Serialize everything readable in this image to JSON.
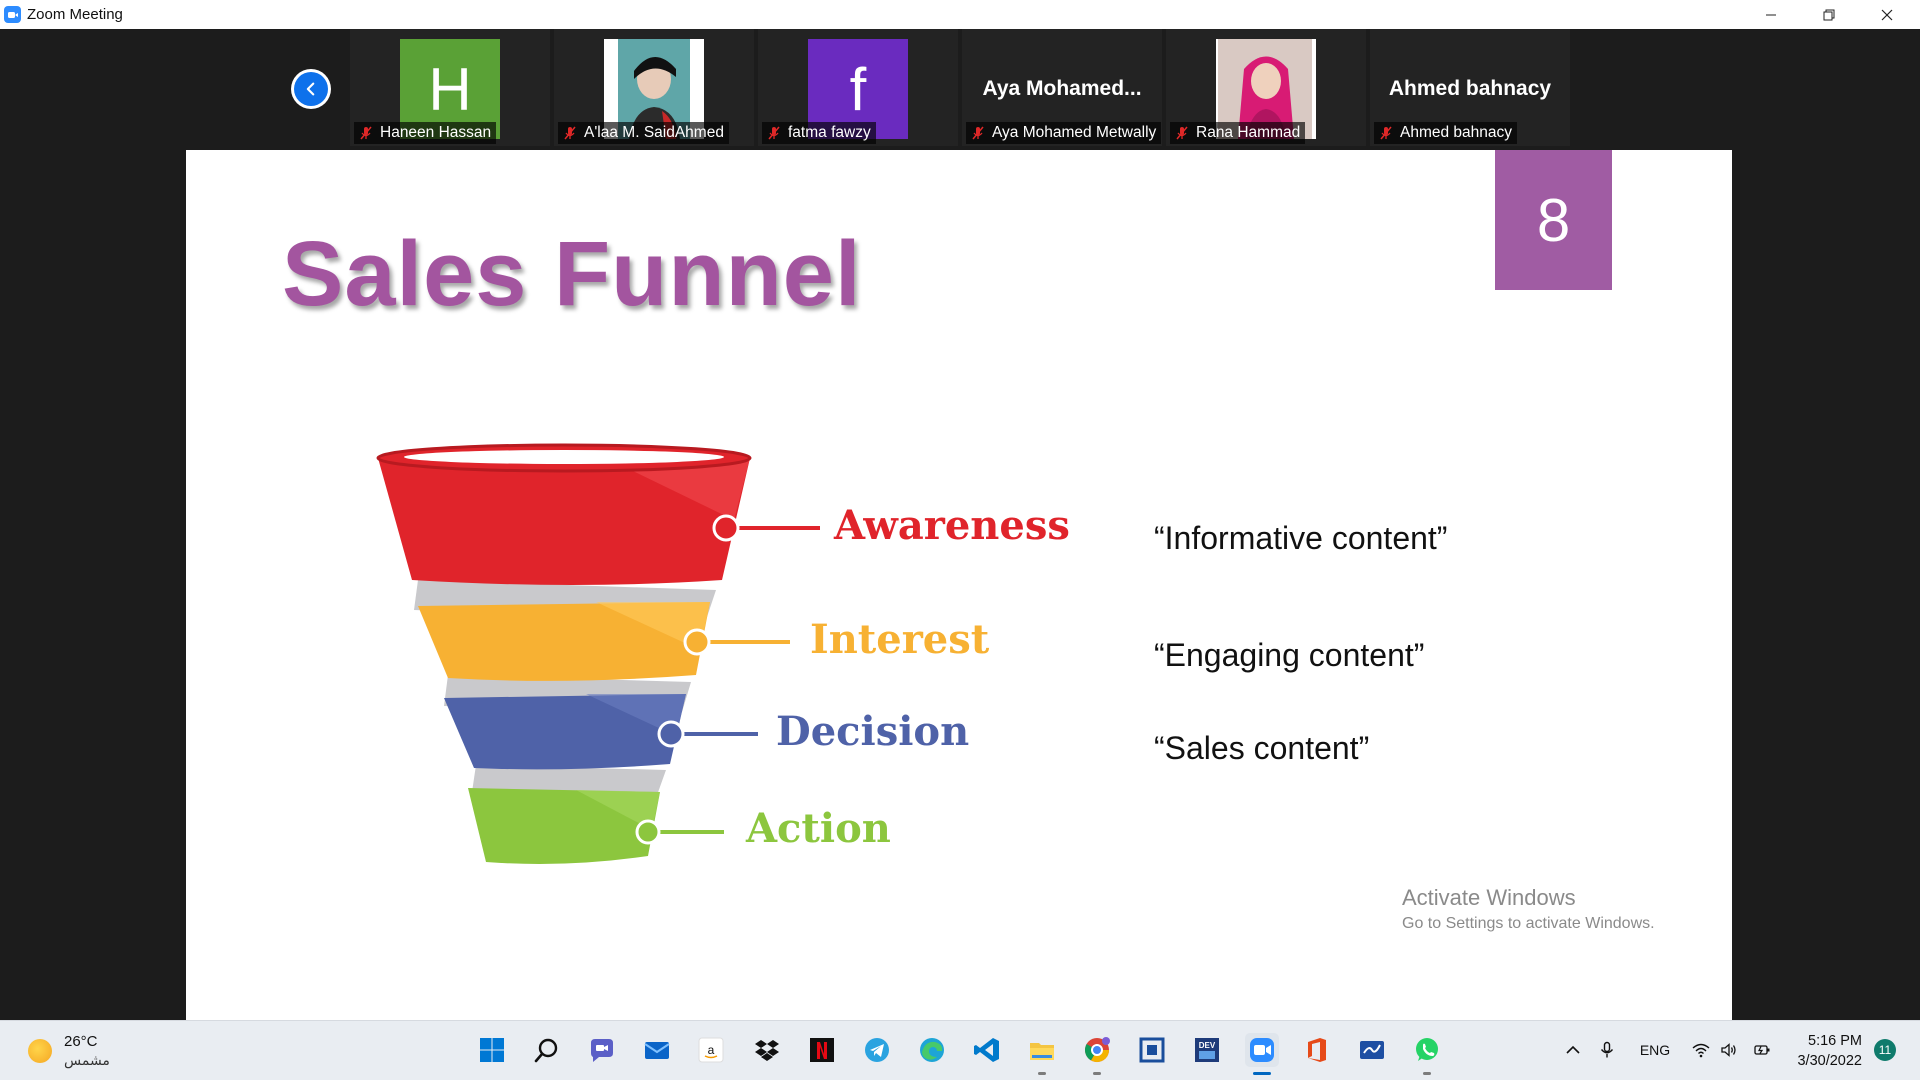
{
  "window": {
    "title": "Zoom Meeting",
    "controls": [
      "minimize-icon",
      "restore-icon",
      "close-icon"
    ]
  },
  "participants": [
    {
      "name": "Haneen Hassan",
      "avatar_type": "letter",
      "letter": "H",
      "avatar_color": "#5aa136",
      "muted": true
    },
    {
      "name": "A'laa M. SaidAhmed",
      "avatar_type": "photo",
      "muted": true
    },
    {
      "name": "fatma fawzy",
      "avatar_type": "letter",
      "letter": "f",
      "avatar_color": "#6a2bbf",
      "muted": true
    },
    {
      "name": "Aya Mohamed Metwally",
      "avatar_type": "text",
      "display_text": "Aya  Mohamed...",
      "muted": true
    },
    {
      "name": "Rana Hammad",
      "avatar_type": "photo",
      "muted": true
    },
    {
      "name": "Ahmed bahnacy",
      "avatar_type": "text",
      "display_text": "Ahmed bahnacy",
      "muted": true
    }
  ],
  "slide": {
    "title": "Sales Funnel",
    "number": "8",
    "number_box_color": "#a05ca3",
    "title_color": "#a3559f",
    "stages": [
      {
        "label": "Awareness",
        "color": "#e0242b"
      },
      {
        "label": "Interest",
        "color": "#f7b133"
      },
      {
        "label": "Decision",
        "color": "#4f62a8"
      },
      {
        "label": "Action",
        "color": "#8cc63e"
      }
    ],
    "quotes": [
      "“Informative content”",
      "“Engaging content”",
      "“Sales content”"
    ]
  },
  "watermark": {
    "line1": "Activate Windows",
    "line2": "Go to Settings to activate Windows."
  },
  "taskbar": {
    "weather": {
      "temp": "26°C",
      "condition": "مشمس"
    },
    "apps": [
      "windows-start-icon",
      "search-icon",
      "teams-chat-icon",
      "mail-icon",
      "amazon-icon",
      "dropbox-icon",
      "netflix-icon",
      "telegram-icon",
      "edge-icon",
      "vscode-icon",
      "file-explorer-icon",
      "chrome-icon",
      "snipping-tool-icon",
      "devc-icon",
      "zoom-icon",
      "office-icon",
      "whiteboard-icon",
      "whatsapp-icon"
    ],
    "active_app": "zoom-icon",
    "tray": {
      "language": "ENG"
    },
    "clock": {
      "time": "5:16 PM",
      "date": "3/30/2022"
    },
    "notifications": "11"
  }
}
